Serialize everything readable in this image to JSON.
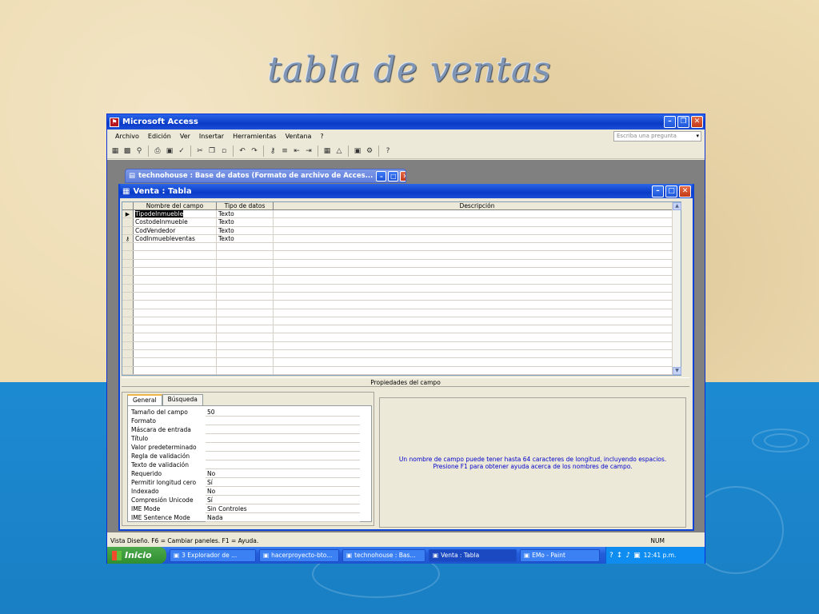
{
  "slide": {
    "title": "tabla de ventas"
  },
  "app": {
    "title": "Microsoft Access",
    "menu": [
      "Archivo",
      "Edición",
      "Ver",
      "Insertar",
      "Herramientas",
      "Ventana",
      "?"
    ],
    "help_placeholder": "Escriba una pregunta"
  },
  "db_window": {
    "title": "technohouse : Base de datos (Formato de archivo de Acces..."
  },
  "table_window": {
    "title": "Venta : Tabla",
    "columns": [
      "Nombre del campo",
      "Tipo de datos",
      "Descripción"
    ],
    "rows": [
      {
        "marker": "▶",
        "name": "TipodeInmueble",
        "type": "Texto",
        "description": ""
      },
      {
        "marker": "",
        "name": "CostodeInmueble",
        "type": "Texto",
        "description": ""
      },
      {
        "marker": "",
        "name": "CodVendedor",
        "type": "Texto",
        "description": ""
      },
      {
        "marker": "⚷",
        "name": "CodInmuebleventas",
        "type": "Texto",
        "description": ""
      }
    ],
    "properties_heading": "Propiedades del campo",
    "tabs": [
      "General",
      "Búsqueda"
    ],
    "properties": [
      {
        "label": "Tamaño del campo",
        "value": "50"
      },
      {
        "label": "Formato",
        "value": ""
      },
      {
        "label": "Máscara de entrada",
        "value": ""
      },
      {
        "label": "Título",
        "value": ""
      },
      {
        "label": "Valor predeterminado",
        "value": ""
      },
      {
        "label": "Regla de validación",
        "value": ""
      },
      {
        "label": "Texto de validación",
        "value": ""
      },
      {
        "label": "Requerido",
        "value": "No"
      },
      {
        "label": "Permitir longitud cero",
        "value": "Sí"
      },
      {
        "label": "Indexado",
        "value": "No"
      },
      {
        "label": "Compresión Unicode",
        "value": "Sí"
      },
      {
        "label": "IME Mode",
        "value": "Sin Controles"
      },
      {
        "label": "IME Sentence Mode",
        "value": "Nada"
      }
    ],
    "help_text": "Un nombre de campo puede tener hasta 64 caracteres de longitud, incluyendo espacios. Presione F1 para obtener ayuda acerca de los nombres de campo."
  },
  "status": {
    "left": "Vista Diseño.  F6 = Cambiar paneles.  F1 = Ayuda.",
    "num": "NUM"
  },
  "taskbar": {
    "start": "Inicio",
    "tasks": [
      {
        "label": "3 Explorador de ...",
        "active": false
      },
      {
        "label": "hacerproyecto-bto...",
        "active": false
      },
      {
        "label": "technohouse : Bas...",
        "active": false
      },
      {
        "label": "Venta : Tabla",
        "active": true
      },
      {
        "label": "EMo - Paint",
        "active": false
      }
    ],
    "time": "12:41 p.m."
  }
}
